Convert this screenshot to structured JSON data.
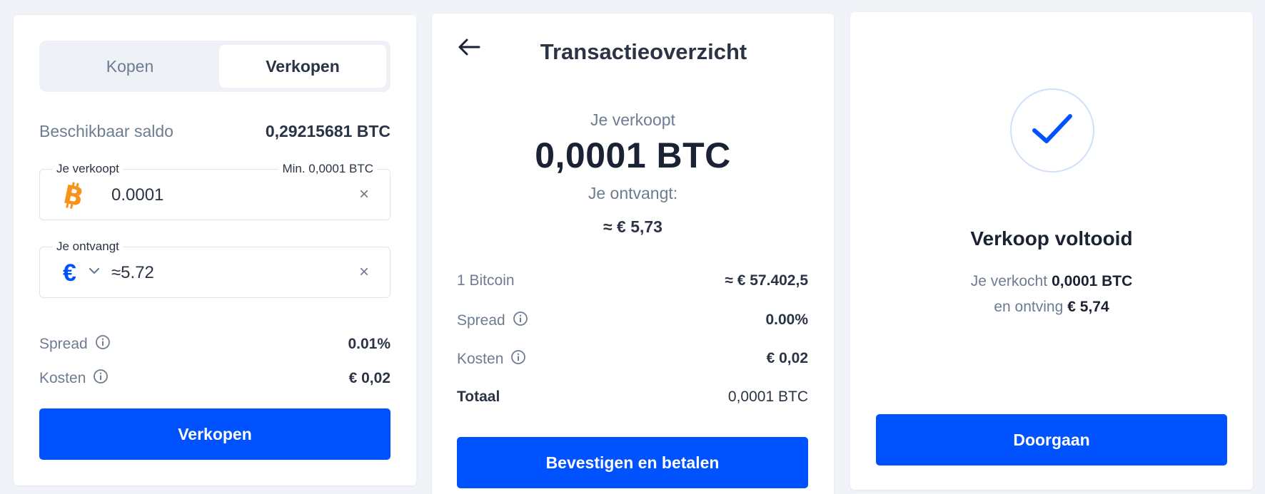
{
  "colors": {
    "primary": "#0052ff",
    "bitcoin": "#f7931a",
    "euro": "#0052ff",
    "muted": "#6e7c91"
  },
  "buy_sell": {
    "tabs": [
      {
        "label": "Kopen",
        "active": false
      },
      {
        "label": "Verkopen",
        "active": true
      }
    ],
    "balance_label": "Beschikbaar saldo",
    "balance_value": "0,29215681 BTC",
    "sell_field": {
      "legend": "Je verkoopt",
      "min_label": "Min. 0,0001 BTC",
      "value": "0.0001",
      "currency_icon": "bitcoin-icon"
    },
    "receive_field": {
      "legend": "Je ontvangt",
      "value": "≈5.72",
      "currency_icon": "euro-icon"
    },
    "spread_label": "Spread",
    "spread_value": "0.01%",
    "costs_label": "Kosten",
    "costs_value": "€ 0,02",
    "submit_label": "Verkopen"
  },
  "overview": {
    "title": "Transactieoverzicht",
    "selling_label": "Je verkoopt",
    "selling_amount": "0,0001 BTC",
    "receive_label": "Je ontvangt:",
    "receive_amount": "≈ € 5,73",
    "details": {
      "rate_label": "1 Bitcoin",
      "rate_value": "≈ € 57.402,5",
      "spread_label": "Spread",
      "spread_value": "0.00%",
      "costs_label": "Kosten",
      "costs_value": "€ 0,02",
      "total_label": "Totaal",
      "total_value": "0,0001 BTC"
    },
    "confirm_label": "Bevestigen en betalen"
  },
  "done": {
    "title": "Verkoop voltooid",
    "sold_prefix": "Je verkocht",
    "sold_value": "0,0001 BTC",
    "received_prefix": "en ontving",
    "received_value": "€ 5,74",
    "continue_label": "Doorgaan"
  }
}
